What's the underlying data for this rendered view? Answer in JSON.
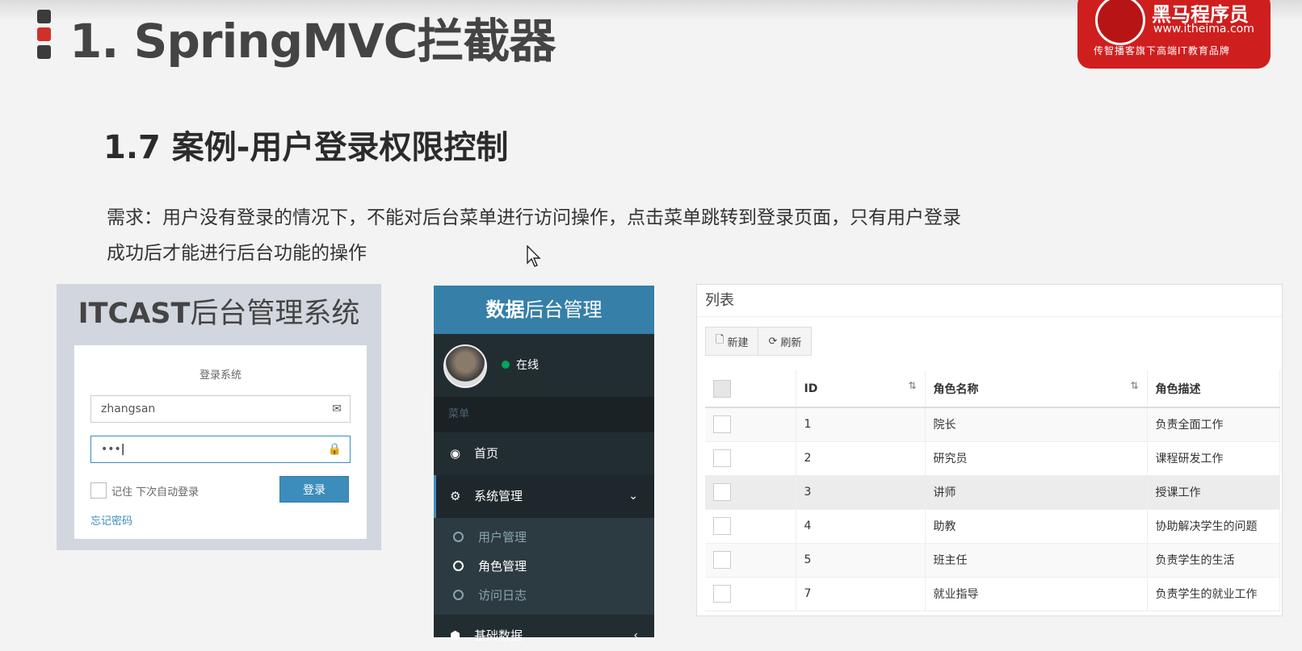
{
  "slide": {
    "title": "1. SpringMVC拦截器",
    "subtitle": "1.7 案例-用户登录权限控制",
    "requirement_line1": "需求：用户没有登录的情况下，不能对后台菜单进行访问操作，点击菜单跳转到登录页面，只有用户登录",
    "requirement_line2": "成功后才能进行后台功能的操作"
  },
  "logo": {
    "name": "黑马程序员",
    "url": "www.itheima.com",
    "slogan": "传智播客旗下高端IT教育品牌",
    "color": "#cf1e1e"
  },
  "login": {
    "brand_bold": "ITCAST",
    "brand_rest": "后台管理系统",
    "box_msg": "登录系统",
    "username_value": "zhangsan",
    "password_value": "•••",
    "remember_label": "记住 下次自动登录",
    "submit_label": "登录",
    "forgot_label": "忘记密码",
    "accent": "#3c8dbc"
  },
  "sidebar": {
    "header_bold": "数据",
    "header_rest": "后台管理",
    "status": "在线",
    "section": "菜单",
    "items": [
      {
        "label": "首页",
        "icon": "dashboard-icon"
      },
      {
        "label": "系统管理",
        "icon": "cogs-icon",
        "active": true
      },
      {
        "label": "基础数据",
        "icon": "cube-icon"
      }
    ],
    "subitems": [
      {
        "label": "用户管理"
      },
      {
        "label": "角色管理",
        "active": true
      },
      {
        "label": "访问日志"
      }
    ]
  },
  "table": {
    "title": "列表",
    "new_label": "新建",
    "refresh_label": "刷新",
    "columns": [
      "ID",
      "角色名称",
      "角色描述"
    ],
    "rows": [
      {
        "id": "1",
        "name": "院长",
        "desc": "负责全面工作"
      },
      {
        "id": "2",
        "name": "研究员",
        "desc": "课程研发工作"
      },
      {
        "id": "3",
        "name": "讲师",
        "desc": "授课工作"
      },
      {
        "id": "4",
        "name": "助教",
        "desc": "协助解决学生的问题"
      },
      {
        "id": "5",
        "name": "班主任",
        "desc": "负责学生的生活"
      },
      {
        "id": "7",
        "name": "就业指导",
        "desc": "负责学生的就业工作"
      }
    ]
  }
}
